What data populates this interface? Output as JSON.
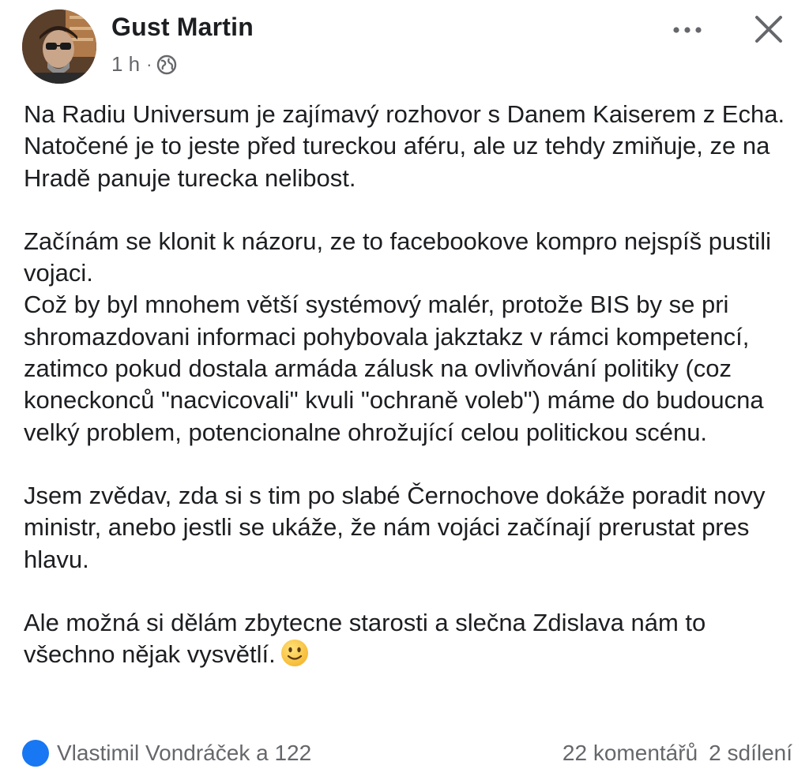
{
  "post": {
    "author": "Gust Martin",
    "time": "1 h",
    "separator": "·",
    "audience_icon": "globe-icon",
    "paragraphs": [
      [
        "Na Radiu Universum je zajímavý rozhovor s Danem Kaiserem z Echa. Natočené je to jeste před tureckou aféru, ale uz tehdy zmiňuje, ze na Hradě panuje turecka nelibost."
      ],
      [
        "Začínám se klonit k názoru, ze to facebookove kompro nejspíš pustili vojaci.",
        "Což by byl mnohem větší systémový malér, protože BIS by se pri shromazdovani informaci pohybovala jakztakz v rámci kompetencí, zatimco pokud dostala armáda zálusk na ovlivňování politiky (coz koneckonců \"nacvicovali\" kvuli \"ochraně voleb\") máme do budoucna velký problem, potencionalne ohrožující celou politickou scénu."
      ],
      [
        "Jsem zvědav, zda si s tim po slabé Černochove dokáže poradit novy ministr, anebo jestli se ukáže, že nám vojáci začínají prerustat pres hlavu."
      ],
      [
        "Ale možná si dělám zbytecne starosti a slečna Zdislava nám to všechno nějak vysvětlí."
      ]
    ],
    "trailing_emoji": "slightly-smiling-face-emoji"
  },
  "header": {
    "more_icon": "more-horizontal-icon",
    "close_icon": "close-icon"
  },
  "reactions": {
    "like_icon": "like-icon",
    "names": "Vlastimil Vondráček a 122",
    "comments": "22 komentářů",
    "shares": "2 sdílení"
  },
  "colors": {
    "text": "#1c1e21",
    "secondary": "#65676b",
    "accent": "#1877f2",
    "background": "#ffffff"
  }
}
